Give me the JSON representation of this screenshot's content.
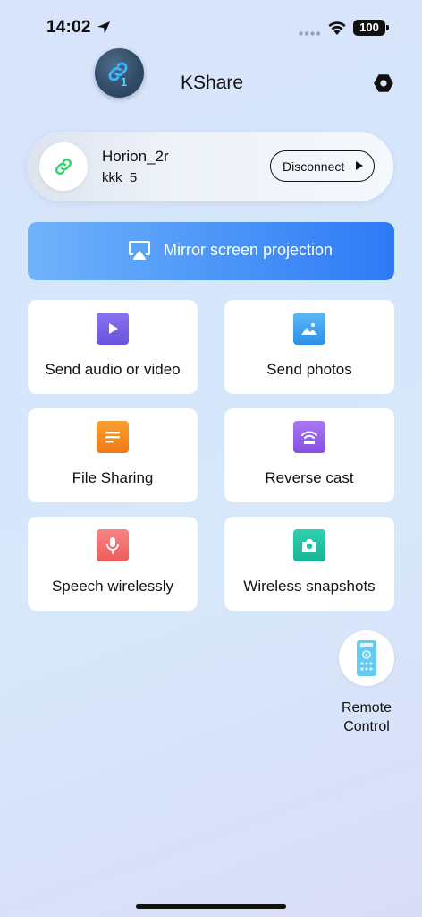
{
  "status_bar": {
    "time": "14:02",
    "battery": "100"
  },
  "header": {
    "title": "KShare",
    "badge_count": "1"
  },
  "device": {
    "name": "Horion_2r",
    "sub": "kkk_5",
    "disconnect_label": "Disconnect"
  },
  "mirror": {
    "label": "Mirror screen projection"
  },
  "features": [
    {
      "label": "Send audio or video",
      "icon": "play-icon",
      "color": "#7b63e6"
    },
    {
      "label": "Send photos",
      "icon": "photo-icon",
      "color": "#3fa3ef"
    },
    {
      "label": "File Sharing",
      "icon": "document-icon",
      "color": "#f58a1f"
    },
    {
      "label": "Reverse cast",
      "icon": "cast-icon",
      "color": "#9a63ea"
    },
    {
      "label": "Speech wirelessly",
      "icon": "microphone-icon",
      "color": "#f26a6a"
    },
    {
      "label": "Wireless snapshots",
      "icon": "camera-icon",
      "color": "#22c3a4"
    }
  ],
  "remote": {
    "label_line1": "Remote",
    "label_line2": "Control"
  },
  "colors": {
    "accent": "#2e7af6",
    "device_link": "#2fd36a"
  }
}
